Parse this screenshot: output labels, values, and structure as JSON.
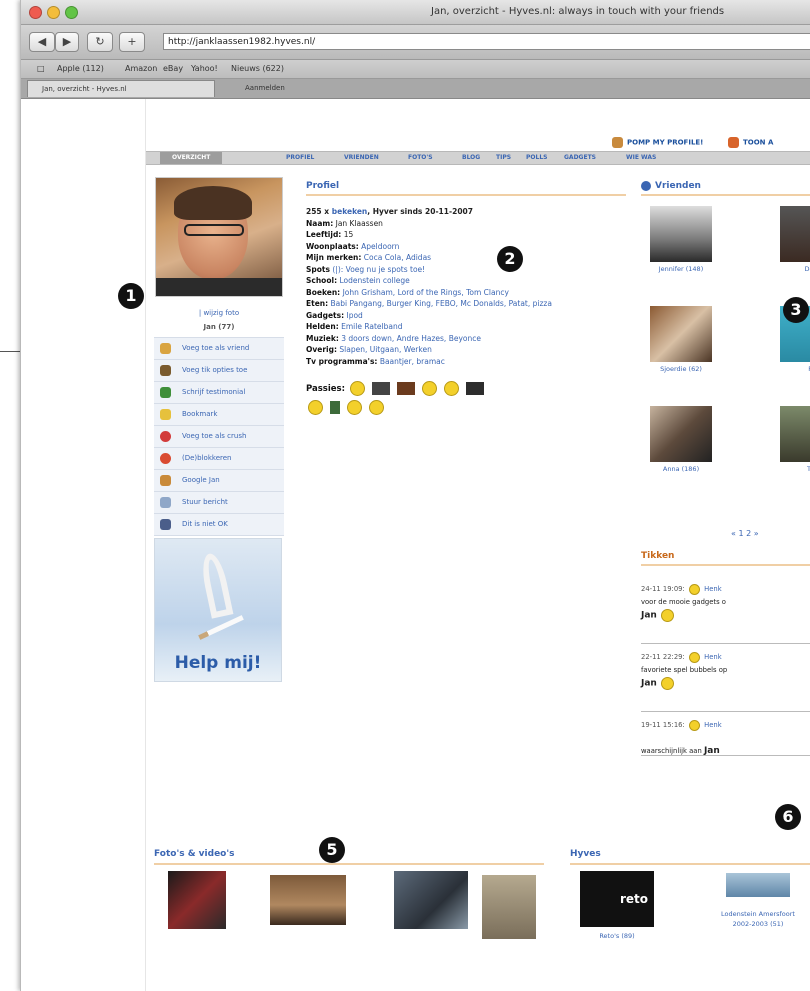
{
  "window": {
    "title": "Jan, overzicht - Hyves.nl: always in touch with your friends",
    "url": "http://janklaassen1982.hyves.nl/"
  },
  "bookmarks_bar": [
    "Apple (112)",
    "Amazon",
    "eBay",
    "Yahoo!",
    "Nieuws (622)"
  ],
  "tabs": [
    {
      "label": "Jan, overzicht - Hyves.nl",
      "active": true
    },
    {
      "label": "Aanmelden",
      "active": false
    }
  ],
  "top_links": [
    {
      "label": "POMP MY PROFILE!",
      "icon": "pimp-icon"
    },
    {
      "label": "TOON A",
      "icon": "toon-icon"
    }
  ],
  "nav": [
    "OVERZICHT",
    "PROFIEL",
    "VRIENDEN",
    "FOTO'S",
    "BLOG",
    "TIPS",
    "POLLS",
    "GADGETS",
    "WIE WAS"
  ],
  "left": {
    "change_photo": "| wijzig foto",
    "username": "Jan (77)",
    "actions": [
      {
        "label": "Voeg toe als vriend",
        "icon": "add-friend-icon",
        "color": "#d9a441"
      },
      {
        "label": "Voeg tik opties toe",
        "icon": "pencil-icon",
        "color": "#7a5b2e"
      },
      {
        "label": "Schrijf testimonial",
        "icon": "testimonial-icon",
        "color": "#3f8f3a"
      },
      {
        "label": "Bookmark",
        "icon": "star-icon",
        "color": "#e6c13c"
      },
      {
        "label": "Voeg toe als crush",
        "icon": "heart-icon",
        "color": "#d23b3b"
      },
      {
        "label": "(De)blokkeren",
        "icon": "block-icon",
        "color": "#d94b32"
      },
      {
        "label": "Google Jan",
        "icon": "google-icon",
        "color": "#c98a3a"
      },
      {
        "label": "Stuur bericht",
        "icon": "message-icon",
        "color": "#8fa7c8"
      },
      {
        "label": "Dit is niet OK",
        "icon": "report-icon",
        "color": "#4b5e8a"
      }
    ],
    "banner_text": "Help mij!"
  },
  "profile": {
    "title": "Profiel",
    "views_prefix": "255 x",
    "views_link": "bekeken",
    "member_since": ", Hyver sinds 20-11-2007",
    "fields": [
      {
        "label": "Naam:",
        "value": "Jan Klaassen",
        "link": false
      },
      {
        "label": "Leeftijd:",
        "value": "15",
        "link": false
      },
      {
        "label": "Woonplaats:",
        "value": "Apeldoorn",
        "link": true
      },
      {
        "label": "Mijn merken:",
        "value": "Coca Cola, Adidas",
        "link": true
      },
      {
        "label": "Spots",
        "value": "(|): Voeg nu je spots toe!",
        "link": true
      },
      {
        "label": "School:",
        "value": "Lodenstein college",
        "link": true
      },
      {
        "label": "Boeken:",
        "value": "John Grisham, Lord of the Rings, Tom Clancy",
        "link": true
      },
      {
        "label": "Eten:",
        "value": "Babi Pangang, Burger King, FEBO, Mc Donalds, Patat, pizza",
        "link": true
      },
      {
        "label": "Gadgets:",
        "value": "Ipod",
        "link": true
      },
      {
        "label": "Helden:",
        "value": "Emile Ratelband",
        "link": true
      },
      {
        "label": "Muziek:",
        "value": "3 doors down, Andre Hazes, Beyonce",
        "link": true
      },
      {
        "label": "Overig:",
        "value": "Slapen, Uitgaan, Werken",
        "link": true
      },
      {
        "label": "Tv programma's:",
        "value": "Baantjer, bramac",
        "link": true
      }
    ],
    "passions_label": "Passies:"
  },
  "friends": {
    "title": "Vrienden",
    "items": [
      {
        "name": "Jennifer (148)"
      },
      {
        "name": "Den"
      },
      {
        "name": "Sjoerdie (62)"
      },
      {
        "name": "Pi"
      },
      {
        "name": "Anna (186)"
      },
      {
        "name": "Th"
      }
    ],
    "pager": "« 1 2 »"
  },
  "tikken": {
    "title": "Tikken",
    "items": [
      {
        "time": "24-11 19:09:",
        "from": "Henk",
        "text": "voor de mooie gadgets o",
        "to": "Jan"
      },
      {
        "time": "22-11 22:29:",
        "from": "Henk",
        "text": "favoriete spel bubbels op",
        "to": "Jan"
      },
      {
        "time": "19-11 15:16:",
        "from": "Henk",
        "text": "waarschijnlijk aan",
        "to": "Jan"
      }
    ]
  },
  "photos": {
    "title": "Foto's & video's"
  },
  "hyves": {
    "title": "Hyves",
    "items": [
      {
        "name": "Reto's (89)",
        "logo_text": "reto"
      },
      {
        "name": "Lodenstein Amersfoort 2002-2003 (51)"
      }
    ]
  },
  "callouts": [
    "1",
    "2",
    "3",
    "5",
    "6"
  ]
}
